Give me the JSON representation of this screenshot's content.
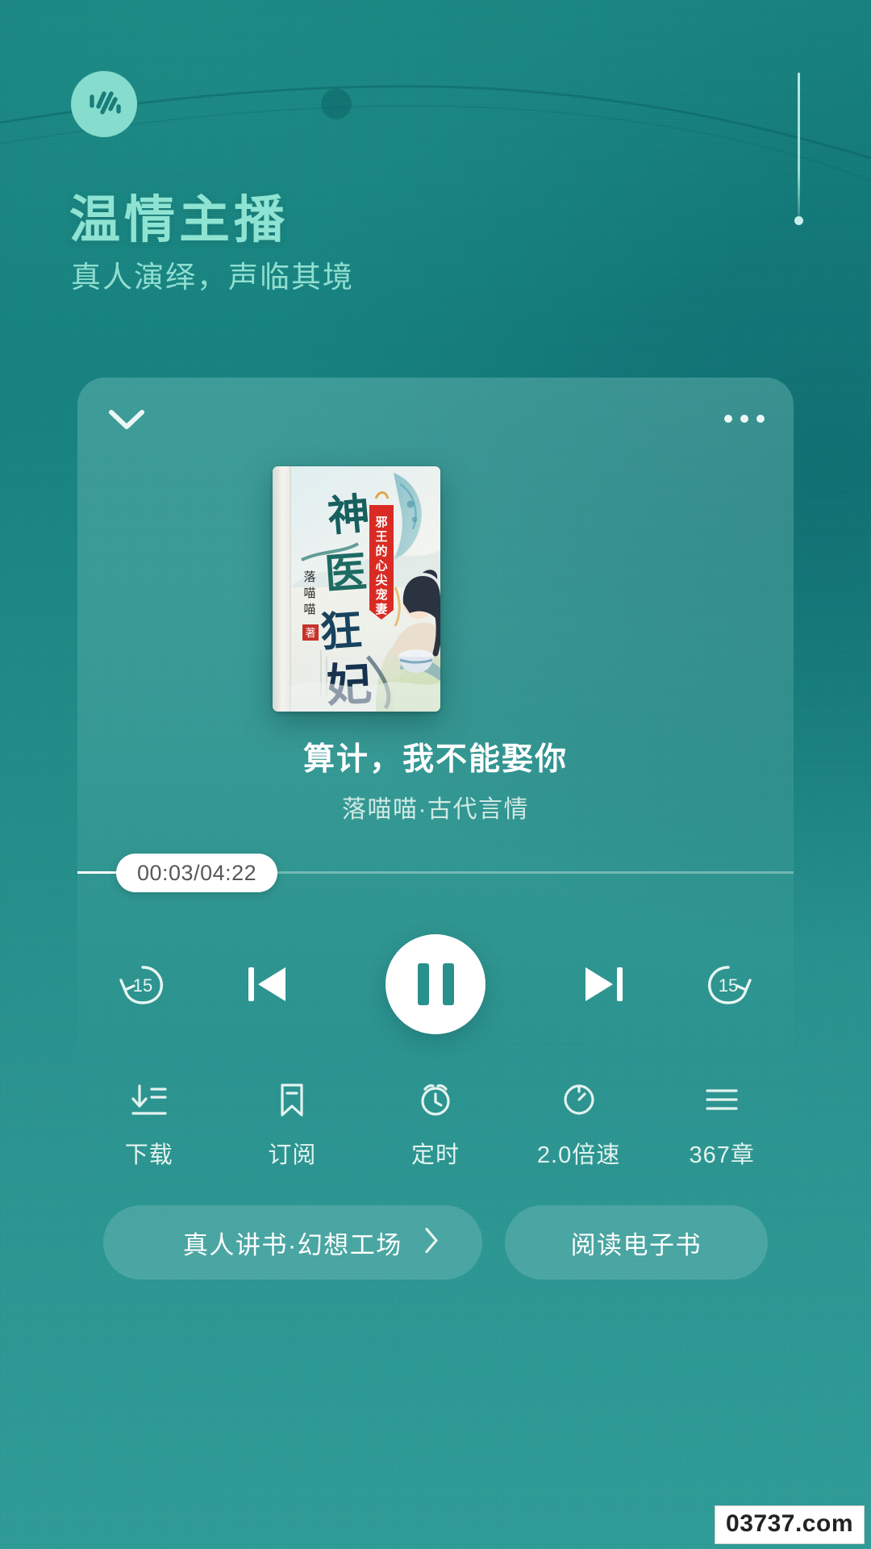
{
  "header": {
    "logo_icon": "soundwave-icon",
    "title": "温情主播",
    "subtitle": "真人演绎，声临其境"
  },
  "player": {
    "collapse_icon": "chevron-down-icon",
    "more_icon": "more-horizontal-icon",
    "cover_alt": "book-cover",
    "cover": {
      "main_title_chars": [
        "神",
        "医",
        "狂",
        "妃"
      ],
      "author_label": "落喵喵",
      "author_seal": "著",
      "banner_text": "邪王的心尖宠妻"
    },
    "track_title": "算计，我不能娶你",
    "track_author": "落喵喵·古代言情",
    "progress": {
      "time_label": "00:03/04:22",
      "elapsed": "00:03",
      "duration": "04:22",
      "percent": 1.1
    },
    "controls": {
      "rewind15": "rewind-15-icon",
      "rewind15_label": "15",
      "previous": "previous-track-icon",
      "playpause": "pause-icon",
      "next": "next-track-icon",
      "forward15": "forward-15-icon",
      "forward15_label": "15"
    },
    "tools": [
      {
        "icon": "download-icon",
        "label": "下载"
      },
      {
        "icon": "bookmark-icon",
        "label": "订阅"
      },
      {
        "icon": "alarm-clock-icon",
        "label": "定时"
      },
      {
        "icon": "speed-gauge-icon",
        "label": "2.0倍速"
      },
      {
        "icon": "list-menu-icon",
        "label": "367章"
      }
    ],
    "bottom": {
      "audiobook_label": "真人讲书·幻想工场",
      "audiobook_chevron": "chevron-right-icon",
      "ebook_label": "阅读电子书"
    }
  },
  "watermark": "03737.com",
  "colors": {
    "background_teal": "#17837f",
    "background_teal_light": "#2e9c97",
    "brand_mint": "#8ee3d2",
    "logo_bg": "#86ddcd",
    "text_white": "#ffffff",
    "text_muted": "#cfe9e4",
    "accent_pause": "#2a908c"
  }
}
